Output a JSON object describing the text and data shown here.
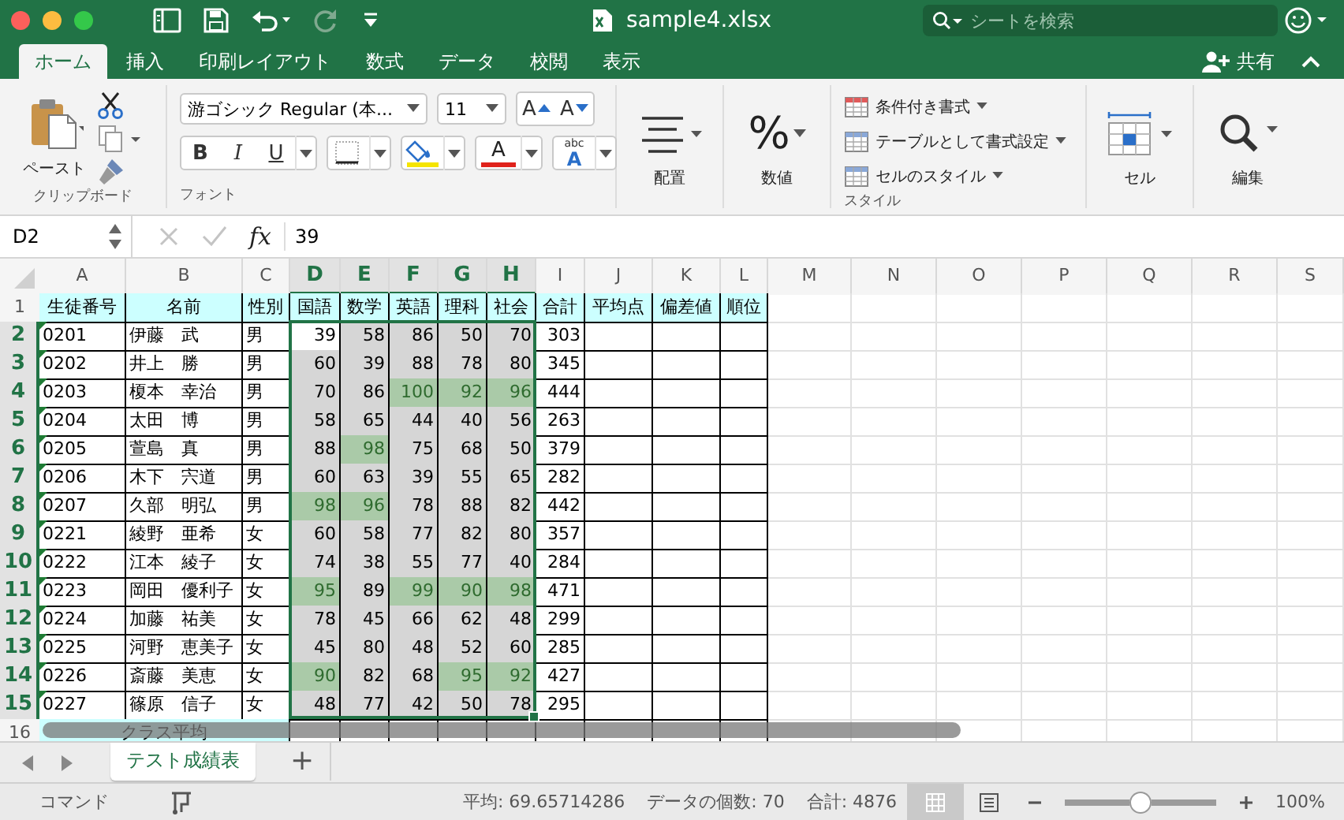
{
  "window": {
    "title": "sample4.xlsx"
  },
  "search": {
    "placeholder": "シートを検索"
  },
  "ribbon_tabs": [
    {
      "label": "ホーム",
      "selected": true
    },
    {
      "label": "挿入",
      "selected": false
    },
    {
      "label": "印刷レイアウト",
      "selected": false
    },
    {
      "label": "数式",
      "selected": false
    },
    {
      "label": "データ",
      "selected": false
    },
    {
      "label": "校閲",
      "selected": false
    },
    {
      "label": "表示",
      "selected": false
    }
  ],
  "share": {
    "label": "共有"
  },
  "ribbon": {
    "clipboard": {
      "paste": "ペースト",
      "label": "クリップボード"
    },
    "font": {
      "name": "游ゴシック Regular (本...",
      "size": "11",
      "grow": "A",
      "shrink": "A",
      "bold": "B",
      "italic": "I",
      "underline": "U",
      "font_color": "A",
      "phonetic": "abc",
      "phonetic_letter": "A",
      "label": "フォント"
    },
    "alignment": {
      "label": "配置"
    },
    "number": {
      "symbol": "%",
      "label": "数値"
    },
    "styles": {
      "items": [
        "条件付き書式",
        "テーブルとして書式設定",
        "セルのスタイル"
      ],
      "label": "スタイル"
    },
    "cells": {
      "label": "セル"
    },
    "editing": {
      "label": "編集"
    }
  },
  "formula_bar": {
    "name_box": "D2",
    "function": "fx",
    "value": "39"
  },
  "sheet": {
    "columns": [
      {
        "label": "A",
        "selected": false
      },
      {
        "label": "B",
        "selected": false
      },
      {
        "label": "C",
        "selected": false
      },
      {
        "label": "D",
        "selected": true
      },
      {
        "label": "E",
        "selected": true
      },
      {
        "label": "F",
        "selected": true
      },
      {
        "label": "G",
        "selected": true
      },
      {
        "label": "H",
        "selected": true
      },
      {
        "label": "I",
        "selected": false
      },
      {
        "label": "J",
        "selected": false
      },
      {
        "label": "K",
        "selected": false
      },
      {
        "label": "L",
        "selected": false
      },
      {
        "label": "M",
        "selected": false
      },
      {
        "label": "N",
        "selected": false
      },
      {
        "label": "O",
        "selected": false
      },
      {
        "label": "P",
        "selected": false
      },
      {
        "label": "Q",
        "selected": false
      },
      {
        "label": "R",
        "selected": false
      },
      {
        "label": "S",
        "selected": false
      }
    ],
    "rows": [
      {
        "label": "1",
        "selected": false
      },
      {
        "label": "2",
        "selected": true
      },
      {
        "label": "3",
        "selected": true
      },
      {
        "label": "4",
        "selected": true
      },
      {
        "label": "5",
        "selected": true
      },
      {
        "label": "6",
        "selected": true
      },
      {
        "label": "7",
        "selected": true
      },
      {
        "label": "8",
        "selected": true
      },
      {
        "label": "9",
        "selected": true
      },
      {
        "label": "10",
        "selected": true
      },
      {
        "label": "11",
        "selected": true
      },
      {
        "label": "12",
        "selected": true
      },
      {
        "label": "13",
        "selected": true
      },
      {
        "label": "14",
        "selected": true
      },
      {
        "label": "15",
        "selected": true
      },
      {
        "label": "16",
        "selected": false
      }
    ],
    "header": [
      "生徒番号",
      "名前",
      "性別",
      "国語",
      "数学",
      "英語",
      "理科",
      "社会",
      "合計",
      "平均点",
      "偏差値",
      "順位"
    ],
    "students": [
      {
        "id": "0201",
        "name": "伊藤　武",
        "gender": "男",
        "flagged": true,
        "total": "303",
        "scores": [
          {
            "value": "39",
            "highlight": false,
            "active": true
          },
          {
            "value": "58",
            "highlight": false,
            "active": false
          },
          {
            "value": "86",
            "highlight": false,
            "active": false
          },
          {
            "value": "50",
            "highlight": false,
            "active": false
          },
          {
            "value": "70",
            "highlight": false,
            "active": false
          }
        ]
      },
      {
        "id": "0202",
        "name": "井上　勝",
        "gender": "男",
        "flagged": true,
        "total": "345",
        "scores": [
          {
            "value": "60",
            "highlight": false,
            "active": false
          },
          {
            "value": "39",
            "highlight": false,
            "active": false
          },
          {
            "value": "88",
            "highlight": false,
            "active": false
          },
          {
            "value": "78",
            "highlight": false,
            "active": false
          },
          {
            "value": "80",
            "highlight": false,
            "active": false
          }
        ]
      },
      {
        "id": "0203",
        "name": "榎本　幸治",
        "gender": "男",
        "flagged": true,
        "total": "444",
        "scores": [
          {
            "value": "70",
            "highlight": false,
            "active": false
          },
          {
            "value": "86",
            "highlight": false,
            "active": false
          },
          {
            "value": "100",
            "highlight": true,
            "active": false
          },
          {
            "value": "92",
            "highlight": true,
            "active": false
          },
          {
            "value": "96",
            "highlight": true,
            "active": false
          }
        ]
      },
      {
        "id": "0204",
        "name": "太田　博",
        "gender": "男",
        "flagged": true,
        "total": "263",
        "scores": [
          {
            "value": "58",
            "highlight": false,
            "active": false
          },
          {
            "value": "65",
            "highlight": false,
            "active": false
          },
          {
            "value": "44",
            "highlight": false,
            "active": false
          },
          {
            "value": "40",
            "highlight": false,
            "active": false
          },
          {
            "value": "56",
            "highlight": false,
            "active": false
          }
        ]
      },
      {
        "id": "0205",
        "name": "萱島　真",
        "gender": "男",
        "flagged": true,
        "total": "379",
        "scores": [
          {
            "value": "88",
            "highlight": false,
            "active": false
          },
          {
            "value": "98",
            "highlight": true,
            "active": false
          },
          {
            "value": "75",
            "highlight": false,
            "active": false
          },
          {
            "value": "68",
            "highlight": false,
            "active": false
          },
          {
            "value": "50",
            "highlight": false,
            "active": false
          }
        ]
      },
      {
        "id": "0206",
        "name": "木下　宍道",
        "gender": "男",
        "flagged": true,
        "total": "282",
        "scores": [
          {
            "value": "60",
            "highlight": false,
            "active": false
          },
          {
            "value": "63",
            "highlight": false,
            "active": false
          },
          {
            "value": "39",
            "highlight": false,
            "active": false
          },
          {
            "value": "55",
            "highlight": false,
            "active": false
          },
          {
            "value": "65",
            "highlight": false,
            "active": false
          }
        ]
      },
      {
        "id": "0207",
        "name": "久部　明弘",
        "gender": "男",
        "flagged": true,
        "total": "442",
        "scores": [
          {
            "value": "98",
            "highlight": true,
            "active": false
          },
          {
            "value": "96",
            "highlight": true,
            "active": false
          },
          {
            "value": "78",
            "highlight": false,
            "active": false
          },
          {
            "value": "88",
            "highlight": false,
            "active": false
          },
          {
            "value": "82",
            "highlight": false,
            "active": false
          }
        ]
      },
      {
        "id": "0221",
        "name": "綾野　亜希",
        "gender": "女",
        "flagged": true,
        "total": "357",
        "scores": [
          {
            "value": "60",
            "highlight": false,
            "active": false
          },
          {
            "value": "58",
            "highlight": false,
            "active": false
          },
          {
            "value": "77",
            "highlight": false,
            "active": false
          },
          {
            "value": "82",
            "highlight": false,
            "active": false
          },
          {
            "value": "80",
            "highlight": false,
            "active": false
          }
        ]
      },
      {
        "id": "0222",
        "name": "江本　綾子",
        "gender": "女",
        "flagged": true,
        "total": "284",
        "scores": [
          {
            "value": "74",
            "highlight": false,
            "active": false
          },
          {
            "value": "38",
            "highlight": false,
            "active": false
          },
          {
            "value": "55",
            "highlight": false,
            "active": false
          },
          {
            "value": "77",
            "highlight": false,
            "active": false
          },
          {
            "value": "40",
            "highlight": false,
            "active": false
          }
        ]
      },
      {
        "id": "0223",
        "name": "岡田　優利子",
        "gender": "女",
        "flagged": true,
        "total": "471",
        "scores": [
          {
            "value": "95",
            "highlight": true,
            "active": false
          },
          {
            "value": "89",
            "highlight": false,
            "active": false
          },
          {
            "value": "99",
            "highlight": true,
            "active": false
          },
          {
            "value": "90",
            "highlight": true,
            "active": false
          },
          {
            "value": "98",
            "highlight": true,
            "active": false
          }
        ]
      },
      {
        "id": "0224",
        "name": "加藤　祐美",
        "gender": "女",
        "flagged": true,
        "total": "299",
        "scores": [
          {
            "value": "78",
            "highlight": false,
            "active": false
          },
          {
            "value": "45",
            "highlight": false,
            "active": false
          },
          {
            "value": "66",
            "highlight": false,
            "active": false
          },
          {
            "value": "62",
            "highlight": false,
            "active": false
          },
          {
            "value": "48",
            "highlight": false,
            "active": false
          }
        ]
      },
      {
        "id": "0225",
        "name": "河野　恵美子",
        "gender": "女",
        "flagged": true,
        "total": "285",
        "scores": [
          {
            "value": "45",
            "highlight": false,
            "active": false
          },
          {
            "value": "80",
            "highlight": false,
            "active": false
          },
          {
            "value": "48",
            "highlight": false,
            "active": false
          },
          {
            "value": "52",
            "highlight": false,
            "active": false
          },
          {
            "value": "60",
            "highlight": false,
            "active": false
          }
        ]
      },
      {
        "id": "0226",
        "name": "斎藤　美恵",
        "gender": "女",
        "flagged": true,
        "total": "427",
        "scores": [
          {
            "value": "90",
            "highlight": true,
            "active": false
          },
          {
            "value": "82",
            "highlight": false,
            "active": false
          },
          {
            "value": "68",
            "highlight": false,
            "active": false
          },
          {
            "value": "95",
            "highlight": true,
            "active": false
          },
          {
            "value": "92",
            "highlight": true,
            "active": false
          }
        ]
      },
      {
        "id": "0227",
        "name": "篠原　信子",
        "gender": "女",
        "flagged": true,
        "total": "295",
        "scores": [
          {
            "value": "48",
            "highlight": false,
            "active": false
          },
          {
            "value": "77",
            "highlight": false,
            "active": false
          },
          {
            "value": "42",
            "highlight": false,
            "active": false
          },
          {
            "value": "50",
            "highlight": false,
            "active": false
          },
          {
            "value": "78",
            "highlight": false,
            "active": false
          }
        ]
      }
    ],
    "footer": "クラス平均"
  },
  "sheet_tabs": [
    {
      "label": "テスト成績表",
      "selected": true
    }
  ],
  "add_sheet": "+",
  "status_bar": {
    "mode": "コマンド",
    "average": "平均: 69.65714286",
    "count": "データの個数: 70",
    "sum": "合計: 4876",
    "zoom": {
      "level": 0.5
    },
    "zoom_label": "100%"
  }
}
